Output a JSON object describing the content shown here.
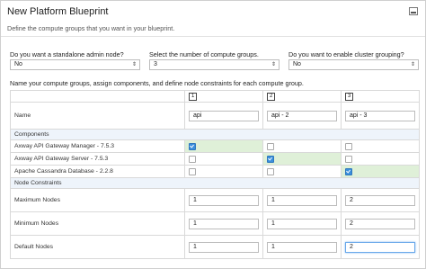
{
  "panel": {
    "title": "New Platform Blueprint",
    "subtitle": "Define the compute groups that you want in your blueprint."
  },
  "questions": [
    {
      "label": "Do you want a standalone admin node?",
      "value": "No"
    },
    {
      "label": "Select the number of compute groups.",
      "value": "3"
    },
    {
      "label": "Do you want to enable cluster grouping?",
      "value": "No"
    }
  ],
  "instruction": "Name your compute groups, assign components, and define node constraints for each compute group.",
  "groups": [
    "1",
    "2",
    "3"
  ],
  "name_row": {
    "label": "Name",
    "values": [
      "api",
      "api - 2",
      "api - 3"
    ]
  },
  "components": {
    "heading": "Components",
    "rows": [
      {
        "label": "Axway API Gateway Manager - 7.5.3",
        "checked": [
          true,
          false,
          false
        ]
      },
      {
        "label": "Axway API Gateway Server - 7.5.3",
        "checked": [
          false,
          true,
          false
        ]
      },
      {
        "label": "Apache Cassandra Database - 2.2.8",
        "checked": [
          false,
          false,
          true
        ]
      }
    ]
  },
  "constraints": {
    "heading": "Node Constraints",
    "rows": [
      {
        "label": "Maximum Nodes",
        "values": [
          "1",
          "1",
          "2"
        ]
      },
      {
        "label": "Minimum Nodes",
        "values": [
          "1",
          "1",
          "2"
        ]
      },
      {
        "label": "Default Nodes",
        "values": [
          "1",
          "1",
          "2"
        ]
      }
    ]
  },
  "colors": {
    "section_bg": "#eef4fb",
    "selected_cell": "#dff0d8",
    "checkbox_on": "#3b8fdc"
  }
}
